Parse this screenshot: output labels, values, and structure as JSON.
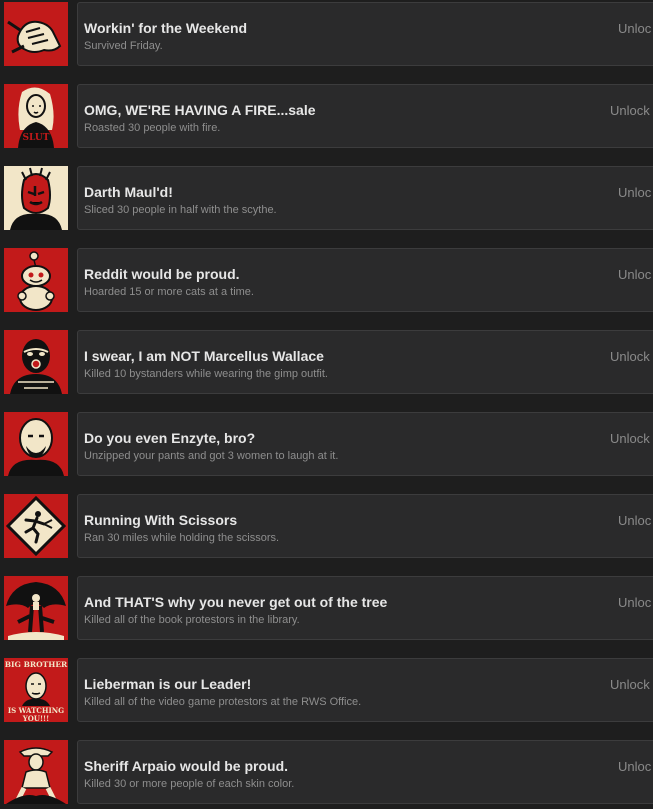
{
  "achievements": [
    {
      "icon": "weekend-fist-icon",
      "title": "Workin' for the Weekend",
      "description": "Survived Friday.",
      "status": "Unloc"
    },
    {
      "icon": "fire-sale-woman-icon",
      "title": "OMG, WE'RE HAVING A FIRE...sale",
      "description": "Roasted 30 people with fire.",
      "status": "Unlock"
    },
    {
      "icon": "darth-maul-icon",
      "title": "Darth Maul'd!",
      "description": "Sliced 30 people in half with the scythe.",
      "status": "Unloc"
    },
    {
      "icon": "reddit-alien-icon",
      "title": "Reddit would be proud.",
      "description": "Hoarded 15 or more cats at a time.",
      "status": "Unloc"
    },
    {
      "icon": "gimp-mask-icon",
      "title": "I swear, I am NOT Marcellus Wallace",
      "description": "Killed 10 bystanders while wearing the gimp outfit.",
      "status": "Unlock"
    },
    {
      "icon": "bald-bro-icon",
      "title": "Do you even Enzyte, bro?",
      "description": "Unzipped your pants and got 3 women to laugh at it.",
      "status": "Unlock"
    },
    {
      "icon": "running-scissors-sign-icon",
      "title": "Running With Scissors",
      "description": "Ran 30 miles while holding the scissors.",
      "status": "Unloc"
    },
    {
      "icon": "tree-icon",
      "title": "And THAT'S why you never get out of the tree",
      "description": "Killed all of the book protestors in the library.",
      "status": "Unloc"
    },
    {
      "icon": "big-brother-poster-icon",
      "title": "Lieberman is our Leader!",
      "description": "Killed all of the video game protestors at the RWS Office.",
      "status": "Unlock"
    },
    {
      "icon": "sheriff-icon",
      "title": "Sheriff Arpaio would be proud.",
      "description": "Killed 30 or more people of each skin color.",
      "status": "Unloc"
    }
  ],
  "poster_text": {
    "top": "BIG BROTHER",
    "middle": "IS WATCHING",
    "bottom": "YOU!!!"
  },
  "colors": {
    "icon_red": "#c21a1a",
    "icon_cream": "#f2e6c8",
    "panel_bg": "#2a2a2b",
    "title_text": "#e6e6e6",
    "desc_text": "#8e8e8e",
    "status_text": "#8a8a8a"
  }
}
